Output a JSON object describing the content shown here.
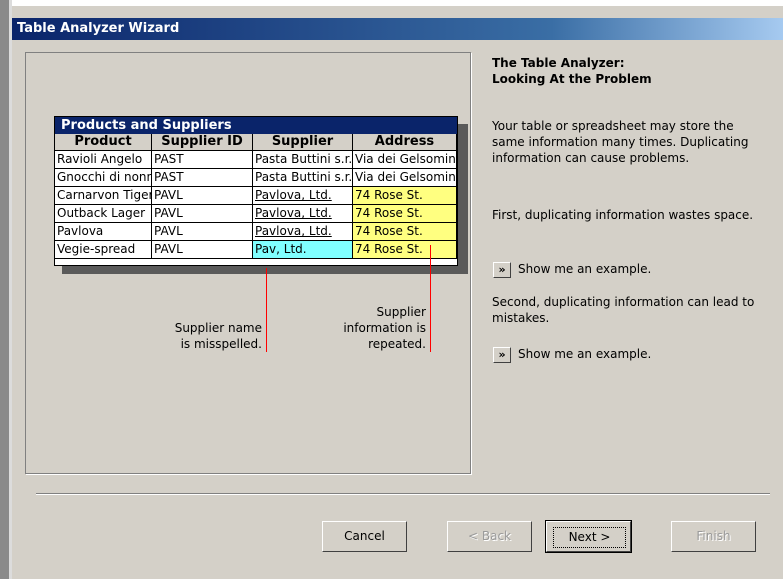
{
  "window": {
    "title": "Table Analyzer Wizard"
  },
  "table": {
    "title": "Products and Suppliers",
    "columns": [
      "Product",
      "Supplier ID",
      "Supplier",
      "Address"
    ],
    "rows": [
      [
        "Ravioli Angelo",
        "PAST",
        "Pasta Buttini s.r.l.",
        "Via dei Gelsomini"
      ],
      [
        "Gnocchi di nonna",
        "PAST",
        "Pasta Buttini s.r.l.",
        "Via dei Gelsomini"
      ],
      [
        "Carnarvon Tigers",
        "PAVL",
        "Pavlova, Ltd.",
        "74 Rose St."
      ],
      [
        "Outback Lager",
        "PAVL",
        "Pavlova, Ltd.",
        "74 Rose St."
      ],
      [
        "Pavlova",
        "PAVL",
        "Pavlova, Ltd.",
        "74 Rose St."
      ],
      [
        "Vegie-spread",
        "PAVL",
        "Pav, Ltd.",
        "74 Rose St."
      ]
    ]
  },
  "annotations": {
    "misspelled_line1": "Supplier name",
    "misspelled_line2": "is misspelled.",
    "repeated_line1": "Supplier",
    "repeated_line2": "information is",
    "repeated_line3": "repeated."
  },
  "info": {
    "heading_line1": "The Table Analyzer:",
    "heading_line2": "Looking At the Problem",
    "para1": "Your table or spreadsheet may store the same information many times. Duplicating information can cause problems.",
    "para2": "First, duplicating information wastes space.",
    "para3": "Second, duplicating information can lead to mistakes.",
    "example_button": "»",
    "example_label": "Show me an example."
  },
  "buttons": {
    "cancel": "Cancel",
    "back": "< Back",
    "next": "Next >",
    "finish": "Finish"
  },
  "colors": {
    "highlight_yellow": "#ffff80",
    "highlight_cyan": "#80ffff",
    "annotation_line": "#ff0000",
    "title_bar": "#0a246a"
  }
}
